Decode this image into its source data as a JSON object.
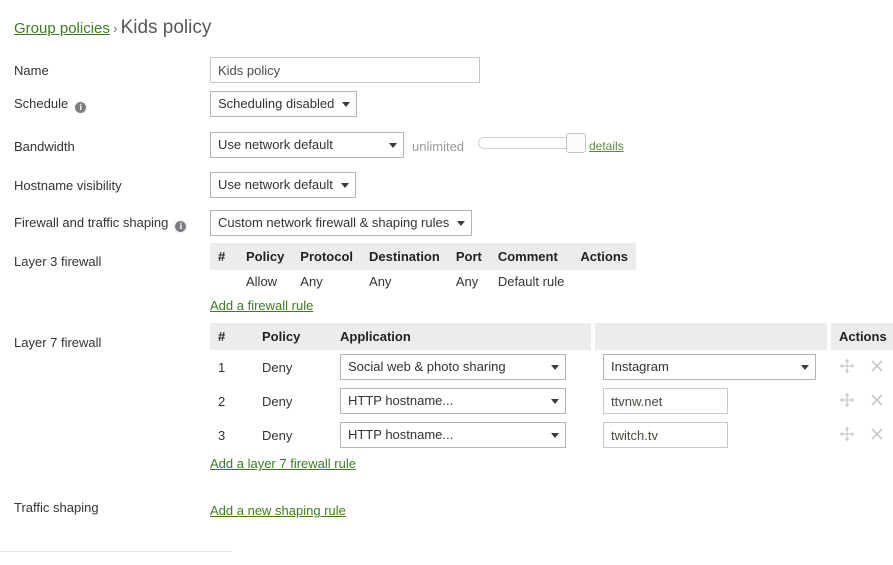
{
  "breadcrumb": {
    "parent_label": "Group policies",
    "separator": "›",
    "current_label": "Kids policy"
  },
  "form": {
    "name": {
      "label": "Name",
      "value": "Kids policy",
      "placeholder": ""
    },
    "schedule": {
      "label": "Schedule",
      "info_glyph": "i",
      "value": "Scheduling disabled"
    },
    "bandwidth": {
      "label": "Bandwidth",
      "value": "Use network default",
      "limit_text": "unlimited",
      "details_label": "details",
      "slider_percent": 100
    },
    "hostname_visibility": {
      "label": "Hostname visibility",
      "value": "Use network default"
    },
    "firewall_traffic_shaping": {
      "label": "Firewall and traffic shaping",
      "info_glyph": "i",
      "value": "Custom network firewall & shaping rules"
    }
  },
  "layer3": {
    "label": "Layer 3 firewall",
    "headers": [
      "#",
      "Policy",
      "Protocol",
      "Destination",
      "Port",
      "Comment",
      "Actions"
    ],
    "rows": [
      {
        "num": "",
        "policy": "Allow",
        "protocol": "Any",
        "destination": "Any",
        "port": "Any",
        "comment": "Default rule",
        "actions": ""
      }
    ],
    "add_link": "Add a firewall rule"
  },
  "layer7": {
    "label": "Layer 7 firewall",
    "headers": [
      "#",
      "Policy",
      "Application",
      "",
      "Actions"
    ],
    "rows": [
      {
        "num": "1",
        "policy": "Deny",
        "type": "Social web & photo sharing",
        "value": "Instagram",
        "value_kind": "select"
      },
      {
        "num": "2",
        "policy": "Deny",
        "type": "HTTP hostname...",
        "value": "ttvnw.net",
        "value_kind": "input"
      },
      {
        "num": "3",
        "policy": "Deny",
        "type": "HTTP hostname...",
        "value": "twitch.tv",
        "value_kind": "input"
      }
    ],
    "add_link": "Add a layer 7 firewall rule",
    "action_icons": {
      "move": "move-icon",
      "delete": "delete-icon"
    }
  },
  "traffic_shaping": {
    "label": "Traffic shaping",
    "add_link": "Add a new shaping rule"
  },
  "colors": {
    "link_green": "#3c7d22",
    "header_gray": "#ececec",
    "text_dark": "#333333",
    "muted_gray": "#9a9a9a",
    "icon_gray": "#c9c9c9"
  }
}
